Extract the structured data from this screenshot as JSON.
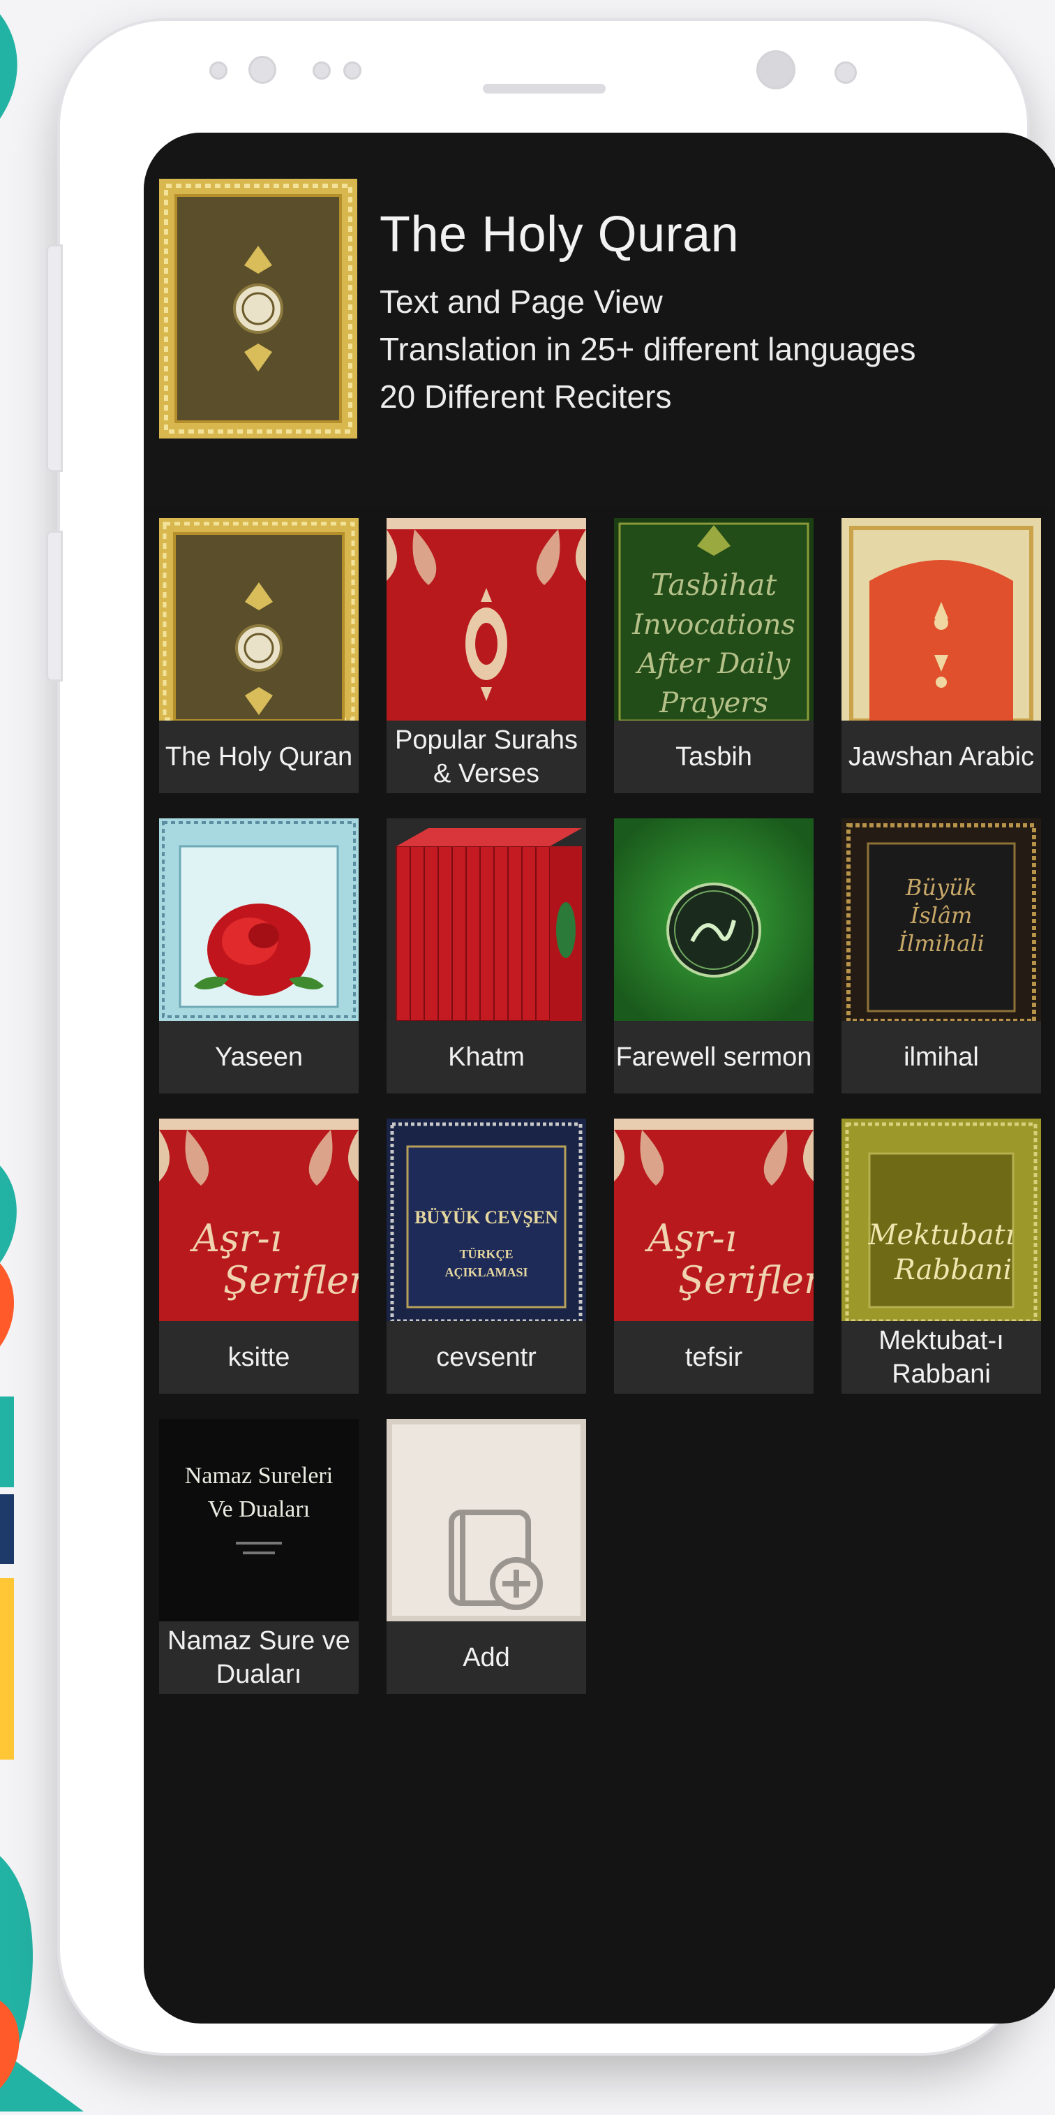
{
  "header": {
    "title": "The Holy Quran",
    "lines": [
      "Text and Page View",
      "Translation in 25+ different languages",
      "20 Different Reciters"
    ]
  },
  "books": [
    {
      "label": "The Holy Quran"
    },
    {
      "label": "Popular Surahs & Verses"
    },
    {
      "label": "Tasbih",
      "cover_text": [
        "Tasbihat",
        "Invocations",
        "After Daily",
        "Prayers"
      ]
    },
    {
      "label": "Jawshan Arabic"
    },
    {
      "label": "Yaseen"
    },
    {
      "label": "Khatm"
    },
    {
      "label": "Farewell sermon"
    },
    {
      "label": "ilmihal",
      "cover_text": [
        "Büyük",
        "İslâm",
        "İlmihali"
      ]
    },
    {
      "label": "ksitte",
      "cover_text": [
        "Aşr-ı",
        "Şerifler"
      ]
    },
    {
      "label": "cevsentr",
      "cover_text": [
        "BÜYÜK CEVŞEN",
        "TÜRKÇE",
        "AÇIKLAMASI"
      ]
    },
    {
      "label": "tefsir",
      "cover_text": [
        "Aşr-ı",
        "Şerifler"
      ]
    },
    {
      "label": "Mektubat-ı Rabbani",
      "cover_text": [
        "Mektubatı",
        "Rabbani"
      ]
    },
    {
      "label": "Namaz Sure ve Duaları",
      "cover_text": [
        "Namaz Sureleri",
        "Ve Duaları"
      ]
    },
    {
      "label": "Add"
    }
  ],
  "colors": {
    "screen_bg": "#141414",
    "tile_label_bg": "#2b2b2b",
    "quran_cover": "#5c4f2c",
    "red_cover": "#b8191c",
    "green_cover": "#1f5d20",
    "olive_cover": "#8e8a24",
    "add_cover": "#ece6df"
  }
}
